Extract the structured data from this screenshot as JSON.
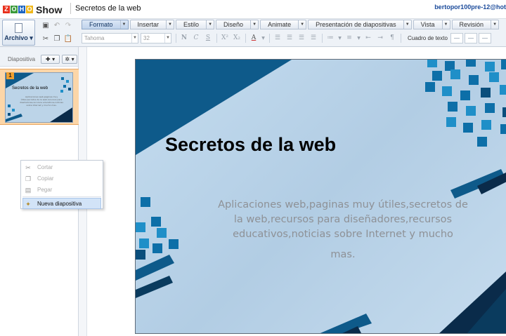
{
  "app": {
    "logo_letters": [
      "Z",
      "O",
      "H",
      "O"
    ],
    "logo_colors": [
      "#e8301c",
      "#3a9a3a",
      "#1b64c2",
      "#f0b71a"
    ],
    "product": "Show",
    "document_title": "Secretos de la web",
    "user": "bertopor100pre-12@hotm"
  },
  "toolbar": {
    "archivo_label": "Archivo",
    "tabs": [
      {
        "label": "Formato",
        "active": true
      },
      {
        "label": "Insertar",
        "active": false
      },
      {
        "label": "Estilo",
        "active": false
      },
      {
        "label": "Diseño",
        "active": false
      },
      {
        "label": "Animate",
        "active": false
      },
      {
        "label": "Presentación de diapositivas",
        "active": false
      },
      {
        "label": "Vista",
        "active": false
      },
      {
        "label": "Revisión",
        "active": false
      }
    ],
    "font_family": "Tahoma",
    "font_size": "32",
    "bold": "N",
    "italic": "C",
    "underline": "S",
    "superscript": "X²",
    "subscript": "X₂",
    "font_color": "A",
    "text_box_label": "Cuadro de texto"
  },
  "slides_panel": {
    "label": "Diapositiva",
    "add_icon": "plus-icon",
    "settings_icon": "gear-icon",
    "slides": [
      {
        "number": "1",
        "title": "Secretos de la web"
      }
    ]
  },
  "context_menu": {
    "items": [
      {
        "label": "Cortar",
        "icon": "scissors-icon",
        "enabled": false
      },
      {
        "label": "Copiar",
        "icon": "copy-icon",
        "enabled": false
      },
      {
        "label": "Pegar",
        "icon": "paste-icon",
        "enabled": false
      },
      {
        "label": "Nueva diapositiva",
        "icon": "new-slide-icon",
        "enabled": true,
        "active": true
      }
    ]
  },
  "slide": {
    "title": "Secretos de la web",
    "subtitle_lines": [
      "Aplicaciones web,paginas muy útiles,secretos",
      "de la web,recursos para diseñadores,recursos",
      "educativos,noticias sobre Internet y mucho",
      "mas."
    ],
    "colors": {
      "background": "#bcd4e8",
      "dark_band": "#0e5a8a",
      "navy": "#0a2b4a",
      "square_dark": "#0d6fa8",
      "square_light": "#1f8fc8"
    }
  }
}
